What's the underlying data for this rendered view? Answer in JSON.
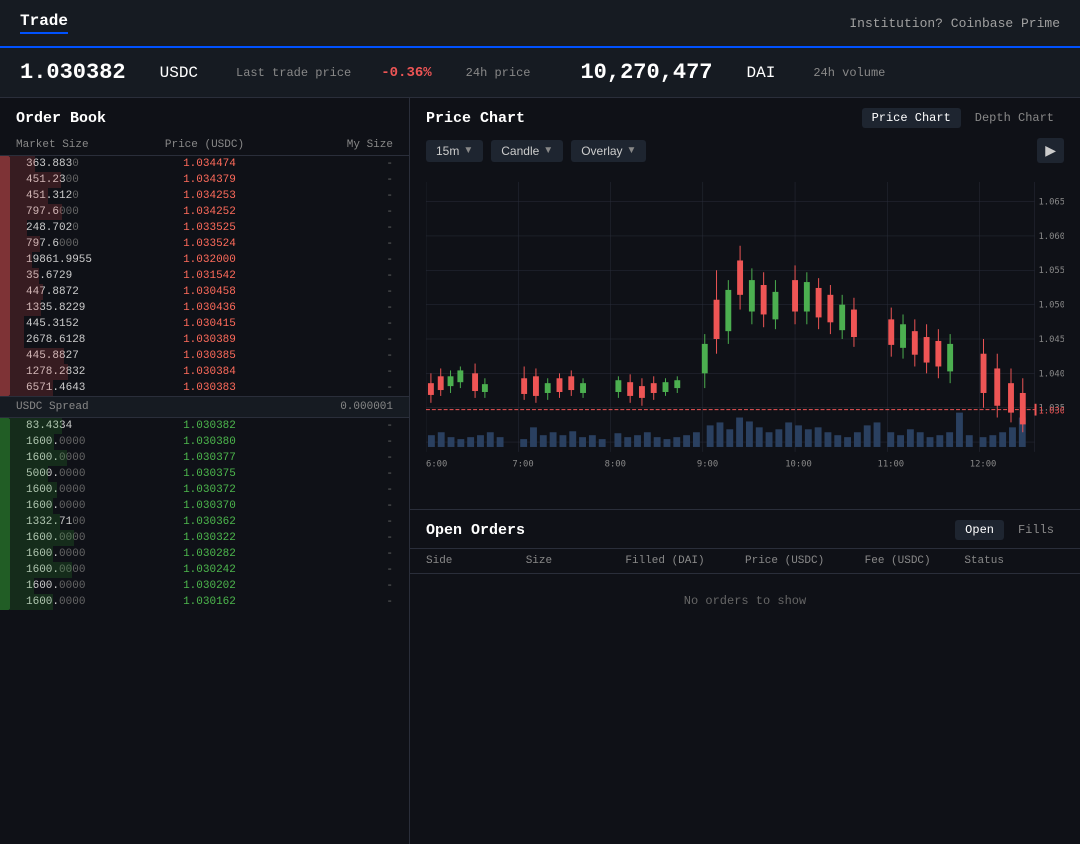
{
  "nav": {
    "trade_label": "Trade",
    "institution_label": "Institution? Coinbase Prime"
  },
  "price_bar": {
    "price": "1.030382",
    "price_currency": "USDC",
    "last_trade_label": "Last trade price",
    "change": "-0.36%",
    "change_label": "24h price",
    "volume": "10,270,477",
    "volume_currency": "DAI",
    "volume_label": "24h volume"
  },
  "order_book": {
    "title": "Order Book",
    "headers": [
      "Market Size",
      "Price (USDC)",
      "My Size"
    ],
    "sell_orders": [
      {
        "size": "363.883",
        "size_dim": "0",
        "price": "1.034474",
        "mysize": "-"
      },
      {
        "size": "451.23",
        "size_dim": "00",
        "price": "1.034379",
        "mysize": "-"
      },
      {
        "size": "451.312",
        "size_dim": "0",
        "price": "1.034253",
        "mysize": "-"
      },
      {
        "size": "797.6",
        "size_dim": "000",
        "price": "1.034252",
        "mysize": "-"
      },
      {
        "size": "248.702",
        "size_dim": "0",
        "price": "1.033525",
        "mysize": "-"
      },
      {
        "size": "797.6",
        "size_dim": "000",
        "price": "1.033524",
        "mysize": "-"
      },
      {
        "size": "19861.9955",
        "size_dim": "",
        "price": "1.032000",
        "mysize": "-"
      },
      {
        "size": "35.6729",
        "size_dim": "",
        "price": "1.031542",
        "mysize": "-"
      },
      {
        "size": "447.8872",
        "size_dim": "",
        "price": "1.030458",
        "mysize": "-"
      },
      {
        "size": "1335.8229",
        "size_dim": "",
        "price": "1.030436",
        "mysize": "-"
      },
      {
        "size": "445.3152",
        "size_dim": "",
        "price": "1.030415",
        "mysize": "-"
      },
      {
        "size": "2678.6128",
        "size_dim": "",
        "price": "1.030389",
        "mysize": "-"
      },
      {
        "size": "445.8827",
        "size_dim": "",
        "price": "1.030385",
        "mysize": "-"
      },
      {
        "size": "1278.2832",
        "size_dim": "",
        "price": "1.030384",
        "mysize": "-"
      },
      {
        "size": "6571.4643",
        "size_dim": "",
        "price": "1.030383",
        "mysize": "-"
      }
    ],
    "spread_label": "USDC Spread",
    "spread_value": "0.000001",
    "buy_orders": [
      {
        "size": "83.4334",
        "size_dim": "",
        "price": "1.030382",
        "mysize": "-"
      },
      {
        "size": "1600.",
        "size_dim": "0000",
        "price": "1.030380",
        "mysize": "-"
      },
      {
        "size": "1600.",
        "size_dim": "0000",
        "price": "1.030377",
        "mysize": "-"
      },
      {
        "size": "5000.",
        "size_dim": "0000",
        "price": "1.030375",
        "mysize": "-"
      },
      {
        "size": "1600.",
        "size_dim": "0000",
        "price": "1.030372",
        "mysize": "-"
      },
      {
        "size": "1600.",
        "size_dim": "0000",
        "price": "1.030370",
        "mysize": "-"
      },
      {
        "size": "1332.71",
        "size_dim": "00",
        "price": "1.030362",
        "mysize": "-"
      },
      {
        "size": "1600.",
        "size_dim": "0000",
        "price": "1.030322",
        "mysize": "-"
      },
      {
        "size": "1600.",
        "size_dim": "0000",
        "price": "1.030282",
        "mysize": "-"
      },
      {
        "size": "1600.",
        "size_dim": "0000",
        "price": "1.030242",
        "mysize": "-"
      },
      {
        "size": "1600.",
        "size_dim": "0000",
        "price": "1.030202",
        "mysize": "-"
      },
      {
        "size": "1600.",
        "size_dim": "0000",
        "price": "1.030162",
        "mysize": "-"
      }
    ]
  },
  "chart": {
    "title": "Price Chart",
    "tabs": [
      "Price Chart",
      "Depth Chart"
    ],
    "active_tab": "Price Chart",
    "controls": {
      "timeframe": "15m",
      "type": "Candle",
      "overlay": "Overlay"
    },
    "current_price_line": "1.030382",
    "y_labels": [
      "1.065",
      "1.060",
      "1.055",
      "1.050",
      "1.045",
      "1.040",
      "1.035"
    ],
    "x_labels": [
      "6:00",
      "7:00",
      "8:00",
      "9:00",
      "10:00",
      "11:00",
      "12:00"
    ]
  },
  "open_orders": {
    "title": "Open Orders",
    "tabs": [
      "Open",
      "Fills"
    ],
    "active_tab": "Open",
    "col_headers": [
      "Side",
      "Size",
      "Filled (DAI)",
      "Price (USDC)",
      "Fee (USDC)",
      "Status"
    ],
    "empty_message": "No orders to show"
  }
}
